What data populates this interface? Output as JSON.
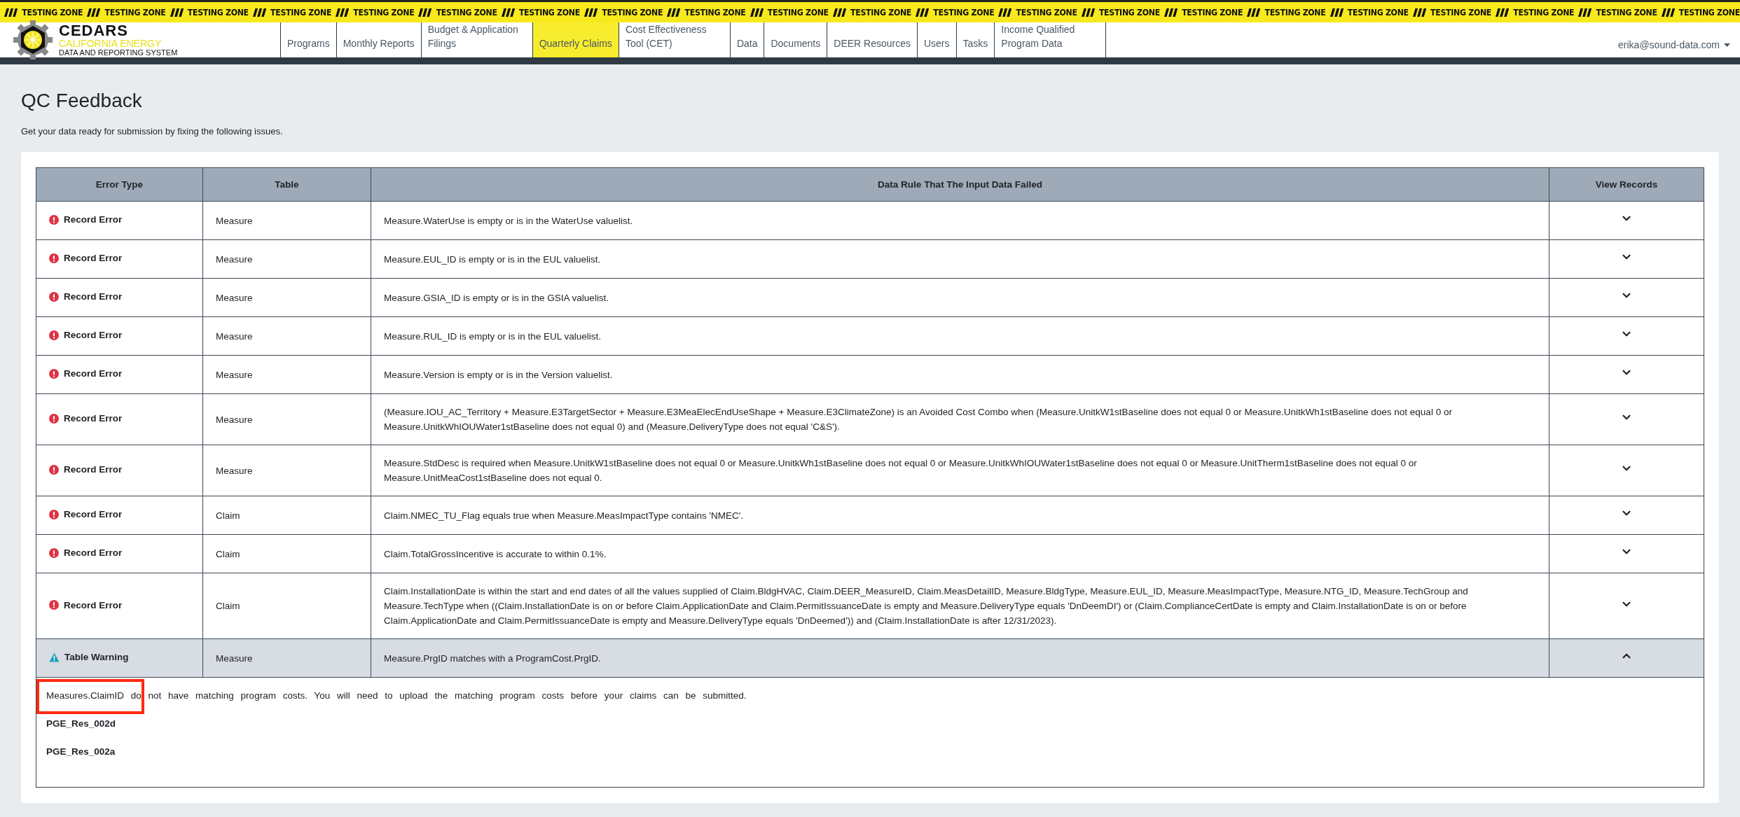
{
  "testing_banner": [
    "TESTING ZONE",
    "TESTING ZONE",
    "TESTING ZONE",
    "TESTING ZONE",
    "TESTING ZONE",
    "TESTING ZONE",
    "TESTING ZONE",
    "TESTING ZONE",
    "TESTING ZONE",
    "TESTING ZONE",
    "TESTING ZONE",
    "TESTING ZONE",
    "TESTING ZONE",
    "TESTING ZONE",
    "TESTING ZONE",
    "TESTING ZONE",
    "TESTING ZONE",
    "TESTING ZONE",
    "TESTING ZONE",
    "TESTING ZONE",
    "TESTING ZONE"
  ],
  "logo": {
    "name": "CEDARS",
    "line_2": "CALIFORNIA ENERGY",
    "line_3": "DATA AND REPORTING SYSTEM"
  },
  "nav": [
    {
      "label": "Programs",
      "selected": false
    },
    {
      "label": "Monthly Reports",
      "selected": false
    },
    {
      "label": "Budget & Application Filings",
      "selected": false
    },
    {
      "label": "Quarterly Claims",
      "selected": true
    },
    {
      "label": "Cost Effectiveness Tool (CET)",
      "selected": false
    },
    {
      "label": "Data",
      "selected": false
    },
    {
      "label": "Documents",
      "selected": false
    },
    {
      "label": "DEER Resources",
      "selected": false
    },
    {
      "label": "Users",
      "selected": false
    },
    {
      "label": "Tasks",
      "selected": false
    },
    {
      "label": "Income Qualified Program Data",
      "selected": false
    }
  ],
  "user_menu": "erika@sound-data.com",
  "page": {
    "title": "QC Feedback",
    "subtitle": "Get your data ready for submission by fixing the following issues."
  },
  "table": {
    "columns": [
      "Error Type",
      "Table",
      "Data Rule That The Input Data Failed",
      "View Records"
    ],
    "rows": [
      {
        "kind": "error",
        "error_type": "Record Error",
        "table": "Measure",
        "rule": "Measure.WaterUse is empty or is in the WaterUse valuelist.",
        "expanded": false
      },
      {
        "kind": "error",
        "error_type": "Record Error",
        "table": "Measure",
        "rule": "Measure.EUL_ID is empty or is in the EUL valuelist.",
        "expanded": false
      },
      {
        "kind": "error",
        "error_type": "Record Error",
        "table": "Measure",
        "rule": "Measure.GSIA_ID is empty or is in the GSIA valuelist.",
        "expanded": false
      },
      {
        "kind": "error",
        "error_type": "Record Error",
        "table": "Measure",
        "rule": "Measure.RUL_ID is empty or is in the EUL valuelist.",
        "expanded": false
      },
      {
        "kind": "error",
        "error_type": "Record Error",
        "table": "Measure",
        "rule": "Measure.Version is empty or is in the Version valuelist.",
        "expanded": false
      },
      {
        "kind": "error",
        "error_type": "Record Error",
        "table": "Measure",
        "rule": "(Measure.IOU_AC_Territory + Measure.E3TargetSector + Measure.E3MeaElecEndUseShape + Measure.E3ClimateZone) is an Avoided Cost Combo when (Measure.UnitkW1stBaseline does not equal 0 or Measure.UnitkWh1stBaseline does not equal 0 or Measure.UnitkWhIOUWater1stBaseline does not equal 0) and (Measure.DeliveryType does not equal 'C&S').",
        "expanded": false
      },
      {
        "kind": "error",
        "error_type": "Record Error",
        "table": "Measure",
        "rule": "Measure.StdDesc is required when Measure.UnitkW1stBaseline does not equal 0 or Measure.UnitkWh1stBaseline does not equal 0 or Measure.UnitkWhIOUWater1stBaseline does not equal 0 or Measure.UnitTherm1stBaseline does not equal 0 or Measure.UnitMeaCost1stBaseline does not equal 0.",
        "expanded": false
      },
      {
        "kind": "error",
        "error_type": "Record Error",
        "table": "Claim",
        "rule": "Claim.NMEC_TU_Flag equals true when Measure.MeasImpactType contains 'NMEC'.",
        "expanded": false
      },
      {
        "kind": "error",
        "error_type": "Record Error",
        "table": "Claim",
        "rule": "Claim.TotalGrossIncentive is accurate to within 0.1%.",
        "expanded": false
      },
      {
        "kind": "error",
        "error_type": "Record Error",
        "table": "Claim",
        "rule": "Claim.InstallationDate is within the start and end dates of all the values supplied of Claim.BldgHVAC, Claim.DEER_MeasureID, Claim.MeasDetailID, Measure.BldgType, Measure.EUL_ID, Measure.MeasImpactType, Measure.NTG_ID, Measure.TechGroup and Measure.TechType when ((Claim.InstallationDate is on or before Claim.ApplicationDate and Claim.PermitIssuanceDate is empty and Measure.DeliveryType equals 'DnDeemDI') or (Claim.ComplianceCertDate is empty and Claim.InstallationDate is on or before Claim.ApplicationDate and Claim.PermitIssuanceDate is empty and Measure.DeliveryType equals 'DnDeemed')) and (Claim.InstallationDate is after 12/31/2023).",
        "expanded": false
      },
      {
        "kind": "warning",
        "error_type": "Table Warning",
        "table": "Measure",
        "rule": "Measure.PrgID matches with a ProgramCost.PrgID.",
        "expanded": true,
        "details": {
          "message": "Measures.ClaimID do not have matching program costs. You will need to upload the matching program costs before your claims can be submitted.",
          "highlighted": true,
          "records": [
            "PGE_Res_002d",
            "PGE_Res_002a"
          ]
        }
      }
    ]
  }
}
